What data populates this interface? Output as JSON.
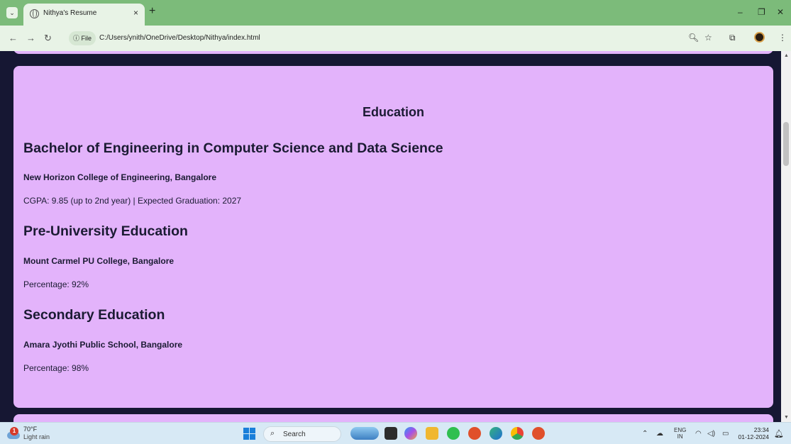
{
  "browser": {
    "tab_title": "Nithya's Resume",
    "tab_close": "×",
    "new_tab": "+",
    "file_chip": "ⓘ File",
    "url": "C:/Users/ynith/OneDrive/Desktop/Nithya/index.html",
    "window_controls": {
      "minimize": "–",
      "restore": "❐",
      "close": "✕"
    }
  },
  "education": {
    "heading": "Education",
    "entries": [
      {
        "degree": "Bachelor of Engineering in Computer Science and Data Science",
        "institution": "New Horizon College of Engineering, Bangalore",
        "detail": "CGPA: 9.85 (up to 2nd year) | Expected Graduation: 2027"
      },
      {
        "degree": "Pre-University Education",
        "institution": "Mount Carmel PU College, Bangalore",
        "detail": "Percentage: 92%"
      },
      {
        "degree": "Secondary Education",
        "institution": "Amara Jyothi Public School, Bangalore",
        "detail": "Percentage: 98%"
      }
    ]
  },
  "taskbar": {
    "weather_badge": "1",
    "temperature": "70°F",
    "condition": "Light rain",
    "search_placeholder": "Search",
    "lang_top": "ENG",
    "lang_bottom": "IN",
    "time": "23:34",
    "date": "01-12-2024"
  },
  "colors": {
    "tab_strip": "#7cbb7a",
    "page_background": "#161733",
    "card_background": "#e3b3fb"
  }
}
